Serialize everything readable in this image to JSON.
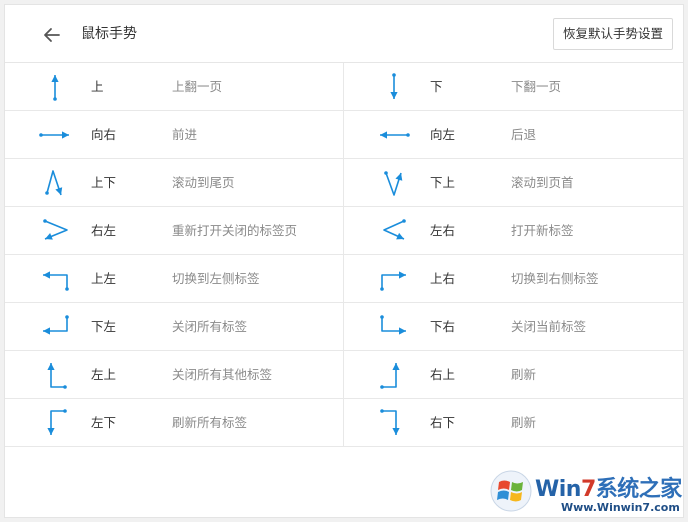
{
  "header": {
    "title": "鼠标手势",
    "reset_button": "恢复默认手势设置"
  },
  "colors": {
    "accent": "#1a8ddb",
    "divider": "#e8e8e8"
  },
  "gestures": [
    {
      "dir": "上",
      "action": "上翻一页",
      "icon": "arrow-up-icon"
    },
    {
      "dir": "下",
      "action": "下翻一页",
      "icon": "arrow-down-icon"
    },
    {
      "dir": "向右",
      "action": "前进",
      "icon": "arrow-right-icon"
    },
    {
      "dir": "向左",
      "action": "后退",
      "icon": "arrow-left-icon"
    },
    {
      "dir": "上下",
      "action": "滚动到尾页",
      "icon": "gesture-up-down-icon"
    },
    {
      "dir": "下上",
      "action": "滚动到页首",
      "icon": "gesture-down-up-icon"
    },
    {
      "dir": "右左",
      "action": "重新打开关闭的标签页",
      "icon": "gesture-right-left-icon"
    },
    {
      "dir": "左右",
      "action": "打开新标签",
      "icon": "gesture-left-right-icon"
    },
    {
      "dir": "上左",
      "action": "切换到左侧标签",
      "icon": "gesture-up-left-icon"
    },
    {
      "dir": "上右",
      "action": "切换到右侧标签",
      "icon": "gesture-up-right-icon"
    },
    {
      "dir": "下左",
      "action": "关闭所有标签",
      "icon": "gesture-down-left-icon"
    },
    {
      "dir": "下右",
      "action": "关闭当前标签",
      "icon": "gesture-down-right-icon"
    },
    {
      "dir": "左上",
      "action": "关闭所有其他标签",
      "icon": "gesture-left-up-icon"
    },
    {
      "dir": "右上",
      "action": "刷新",
      "icon": "gesture-right-up-icon"
    },
    {
      "dir": "左下",
      "action": "刷新所有标签",
      "icon": "gesture-left-down-icon"
    },
    {
      "dir": "右下",
      "action": "刷新",
      "icon": "gesture-right-down-icon"
    }
  ],
  "watermark": {
    "brand_win": "Win",
    "brand_seven": "7",
    "brand_rest": "系统之家",
    "url": "Www.Winwin7.com"
  }
}
